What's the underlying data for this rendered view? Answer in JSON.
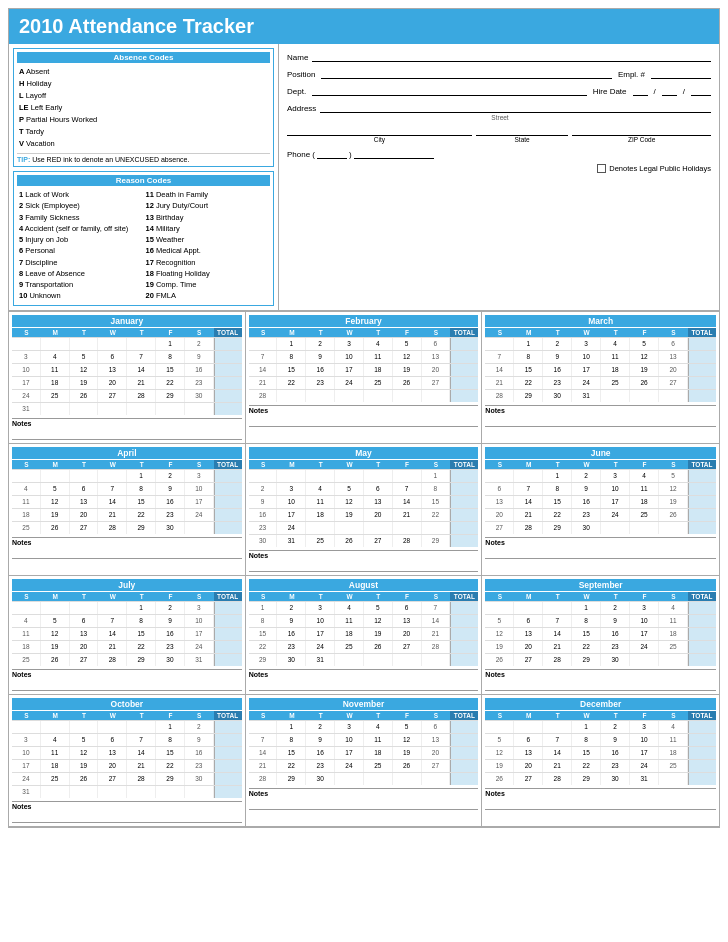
{
  "header": {
    "title": "2010 Attendance Tracker"
  },
  "absence_codes": {
    "title": "Absence Codes",
    "items": [
      {
        "code": "A",
        "label": "Absent"
      },
      {
        "code": "H",
        "label": "Holiday"
      },
      {
        "code": "L",
        "label": "Layoff"
      },
      {
        "code": "LE",
        "label": "Left Early"
      },
      {
        "code": "P",
        "label": "Partial Hours Worked"
      },
      {
        "code": "T",
        "label": "Tardy"
      },
      {
        "code": "V",
        "label": "Vacation"
      }
    ],
    "tip": "TIP: Use RED ink to denote an UNEXCUSED absence."
  },
  "reason_codes": {
    "title": "Reason Codes",
    "col1": [
      {
        "num": "1",
        "label": "Lack of Work"
      },
      {
        "num": "2",
        "label": "Sick (Employee)"
      },
      {
        "num": "3",
        "label": "Family Sickness"
      },
      {
        "num": "4",
        "label": "Accident (self or family, off site)"
      },
      {
        "num": "5",
        "label": "Injury on Job"
      },
      {
        "num": "6",
        "label": "Personal"
      },
      {
        "num": "7",
        "label": "Discipline"
      },
      {
        "num": "8",
        "label": "Leave of Absence"
      },
      {
        "num": "9",
        "label": "Transportation"
      },
      {
        "num": "10",
        "label": "Unknown"
      }
    ],
    "col2": [
      {
        "num": "11",
        "label": "Death in Family"
      },
      {
        "num": "12",
        "label": "Jury Duty/Court"
      },
      {
        "num": "13",
        "label": "Birthday"
      },
      {
        "num": "14",
        "label": "Military"
      },
      {
        "num": "15",
        "label": "Weather"
      },
      {
        "num": "16",
        "label": "Medical Appt."
      },
      {
        "num": "17",
        "label": "Recognition"
      },
      {
        "num": "18",
        "label": "Floating Holiday"
      },
      {
        "num": "19",
        "label": "Comp. Time"
      },
      {
        "num": "20",
        "label": "FMLA"
      }
    ]
  },
  "form": {
    "name_label": "Name",
    "position_label": "Position",
    "empl_label": "Empl. #",
    "dept_label": "Dept.",
    "hire_date_label": "Hire Date",
    "address_label": "Address",
    "street_label": "Street",
    "city_label": "City",
    "state_label": "State",
    "zip_label": "ZIP Code",
    "phone_label": "Phone  (",
    "holidays_label": "Denotes Legal Public Holidays",
    "notes_label": "Notes"
  },
  "months": [
    {
      "name": "January",
      "weeks": [
        [
          null,
          null,
          null,
          null,
          null,
          1,
          2
        ],
        [
          3,
          4,
          5,
          6,
          7,
          8,
          9
        ],
        [
          10,
          11,
          12,
          13,
          14,
          15,
          16
        ],
        [
          17,
          18,
          19,
          20,
          21,
          22,
          23
        ],
        [
          24,
          25,
          26,
          27,
          28,
          29,
          30
        ],
        [
          31,
          null,
          null,
          null,
          null,
          null,
          null
        ]
      ]
    },
    {
      "name": "February",
      "weeks": [
        [
          null,
          1,
          2,
          3,
          4,
          5,
          6
        ],
        [
          7,
          8,
          9,
          10,
          11,
          12,
          13
        ],
        [
          14,
          15,
          16,
          17,
          18,
          19,
          20
        ],
        [
          21,
          22,
          23,
          24,
          25,
          26,
          27
        ],
        [
          28,
          null,
          null,
          null,
          null,
          null,
          null
        ]
      ]
    },
    {
      "name": "March",
      "weeks": [
        [
          null,
          1,
          2,
          3,
          4,
          5,
          6
        ],
        [
          7,
          8,
          9,
          10,
          11,
          12,
          13
        ],
        [
          14,
          15,
          16,
          17,
          18,
          19,
          20
        ],
        [
          21,
          22,
          23,
          24,
          25,
          26,
          27
        ],
        [
          28,
          29,
          30,
          31,
          null,
          null,
          null
        ]
      ]
    },
    {
      "name": "April",
      "weeks": [
        [
          null,
          null,
          null,
          null,
          1,
          2,
          3
        ],
        [
          4,
          5,
          6,
          7,
          8,
          9,
          10
        ],
        [
          11,
          12,
          13,
          14,
          15,
          16,
          17
        ],
        [
          18,
          19,
          20,
          21,
          22,
          23,
          24
        ],
        [
          25,
          26,
          27,
          28,
          29,
          30,
          null
        ]
      ]
    },
    {
      "name": "May",
      "weeks": [
        [
          null,
          null,
          null,
          null,
          null,
          null,
          1
        ],
        [
          2,
          3,
          4,
          5,
          6,
          7,
          8
        ],
        [
          9,
          10,
          11,
          12,
          13,
          14,
          15
        ],
        [
          16,
          17,
          18,
          19,
          20,
          21,
          22
        ],
        [
          23,
          24,
          null,
          null,
          null,
          null,
          null
        ],
        [
          30,
          31,
          25,
          26,
          27,
          28,
          29
        ]
      ]
    },
    {
      "name": "June",
      "weeks": [
        [
          null,
          null,
          1,
          2,
          3,
          4,
          5
        ],
        [
          6,
          7,
          8,
          9,
          10,
          11,
          12
        ],
        [
          13,
          14,
          15,
          16,
          17,
          18,
          19
        ],
        [
          20,
          21,
          22,
          23,
          24,
          25,
          26
        ],
        [
          27,
          28,
          29,
          30,
          null,
          null,
          null
        ]
      ]
    },
    {
      "name": "July",
      "weeks": [
        [
          null,
          null,
          null,
          null,
          1,
          2,
          3
        ],
        [
          4,
          5,
          6,
          7,
          8,
          9,
          10
        ],
        [
          11,
          12,
          13,
          14,
          15,
          16,
          17
        ],
        [
          18,
          19,
          20,
          21,
          22,
          23,
          24
        ],
        [
          25,
          26,
          27,
          28,
          29,
          30,
          31
        ]
      ]
    },
    {
      "name": "August",
      "weeks": [
        [
          1,
          2,
          3,
          4,
          5,
          6,
          7
        ],
        [
          8,
          9,
          10,
          11,
          12,
          13,
          14
        ],
        [
          15,
          16,
          17,
          18,
          19,
          20,
          21
        ],
        [
          22,
          23,
          24,
          25,
          26,
          27,
          28
        ],
        [
          29,
          30,
          31,
          null,
          null,
          null,
          null
        ]
      ]
    },
    {
      "name": "September",
      "weeks": [
        [
          null,
          null,
          null,
          1,
          2,
          3,
          4
        ],
        [
          5,
          6,
          7,
          8,
          9,
          10,
          11
        ],
        [
          12,
          13,
          14,
          15,
          16,
          17,
          18
        ],
        [
          19,
          20,
          21,
          22,
          23,
          24,
          25
        ],
        [
          26,
          27,
          28,
          29,
          30,
          null,
          null
        ]
      ]
    },
    {
      "name": "October",
      "weeks": [
        [
          null,
          null,
          null,
          null,
          null,
          1,
          2
        ],
        [
          3,
          4,
          5,
          6,
          7,
          8,
          9
        ],
        [
          10,
          11,
          12,
          13,
          14,
          15,
          16
        ],
        [
          17,
          18,
          19,
          20,
          21,
          22,
          23
        ],
        [
          24,
          25,
          26,
          27,
          28,
          29,
          30
        ],
        [
          31,
          null,
          null,
          null,
          null,
          null,
          null
        ]
      ]
    },
    {
      "name": "November",
      "weeks": [
        [
          null,
          1,
          2,
          3,
          4,
          5,
          6
        ],
        [
          7,
          8,
          9,
          10,
          11,
          12,
          13
        ],
        [
          14,
          15,
          16,
          17,
          18,
          19,
          20
        ],
        [
          21,
          22,
          23,
          24,
          25,
          26,
          27
        ],
        [
          28,
          29,
          30,
          null,
          null,
          null,
          null
        ]
      ]
    },
    {
      "name": "December",
      "weeks": [
        [
          null,
          null,
          null,
          1,
          2,
          3,
          4
        ],
        [
          5,
          6,
          7,
          8,
          9,
          10,
          11
        ],
        [
          12,
          13,
          14,
          15,
          16,
          17,
          18
        ],
        [
          19,
          20,
          21,
          22,
          23,
          24,
          25
        ],
        [
          26,
          27,
          28,
          29,
          30,
          31,
          null
        ]
      ]
    }
  ],
  "cal_headers": [
    "S",
    "M",
    "T",
    "W",
    "T",
    "F",
    "S",
    "TOTAL"
  ],
  "notes_label": "Notes"
}
